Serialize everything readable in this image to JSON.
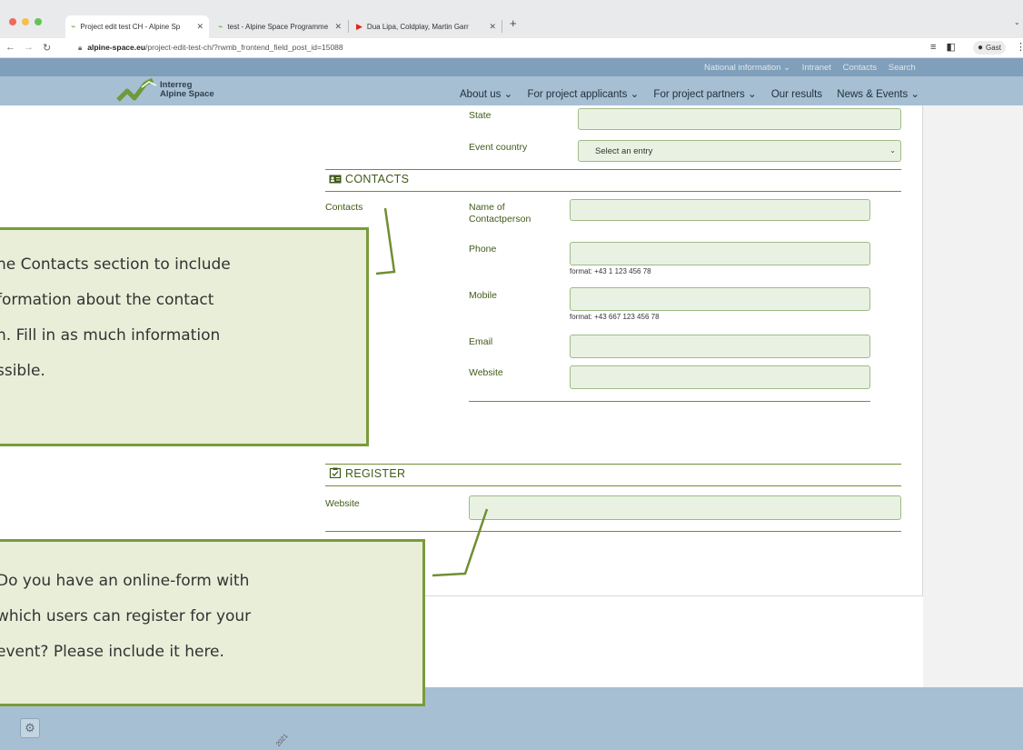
{
  "browser": {
    "tabs": [
      {
        "title": "Project edit test CH - Alpine Sp",
        "active": true
      },
      {
        "title": "test - Alpine Space Programme",
        "active": false
      },
      {
        "title": "Dua Lipa, Coldplay, Martin Garr",
        "active": false
      }
    ],
    "url_host": "alpine-space.eu",
    "url_path": "/project-edit-test-ch/?rwmb_frontend_field_post_id=15088",
    "profile_label": "Gast"
  },
  "site": {
    "logo_line1": "Interreg",
    "logo_line2": "Alpine Space",
    "top_nav": [
      "National information ⌄",
      "Intranet",
      "Contacts",
      "Search"
    ],
    "main_nav": [
      "About us ⌄",
      "For project applicants ⌄",
      "For project partners ⌄",
      "Our results",
      "News & Events ⌄"
    ]
  },
  "form": {
    "state_label": "State",
    "event_country_label": "Event country",
    "event_country_value": "Select an entry",
    "contacts_heading": "CONTACTS",
    "contacts_side_label": "Contacts",
    "contact_name_label_1": "Name of",
    "contact_name_label_2": "Contactperson",
    "phone_label": "Phone",
    "phone_hint": "format: +43 1 123 456 78",
    "mobile_label": "Mobile",
    "mobile_hint": "format: +43 667 123 456 78",
    "email_label": "Email",
    "website_label": "Website",
    "register_heading": "REGISTER",
    "register_website_label": "Website"
  },
  "callouts": {
    "contacts": [
      "he Contacts section to include",
      "formation about the contact",
      "n. Fill in as much information",
      "ssible."
    ],
    "register": [
      "Do you have an online-form with",
      "which users can register for your",
      "event? Please include it here."
    ]
  },
  "footer": {
    "stamp": "2021"
  },
  "colors": {
    "header_blue": "#a7bfd3",
    "top_strip": "#7f9fba",
    "accent_green": "#7a9b3b",
    "field_fill": "#e9f2e2"
  }
}
